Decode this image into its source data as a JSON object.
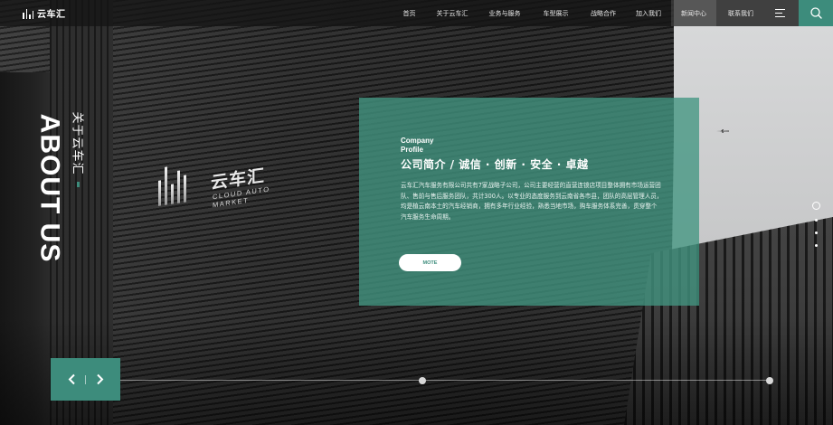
{
  "brand": {
    "logo_text": "云车汇",
    "accent_color": "#3d8c7c"
  },
  "nav": {
    "items": [
      {
        "label": "首页",
        "active": false
      },
      {
        "label": "关于云车汇",
        "active": false
      },
      {
        "label": "业务与服务",
        "active": false
      },
      {
        "label": "车型展示",
        "active": false
      },
      {
        "label": "战略合作",
        "active": false
      },
      {
        "label": "加入我们",
        "active": false
      },
      {
        "label": "新闻中心",
        "active": true
      },
      {
        "label": "联系我们",
        "active": false
      }
    ],
    "menu_icon": "hamburger-icon",
    "search_icon": "search-icon"
  },
  "hero": {
    "title_en": "ABOUT US",
    "title_cn": "关于云车汇"
  },
  "wall_sign": {
    "cn": "云车汇",
    "en_line1": "CLOUD AUTO",
    "en_line2": "MARKET"
  },
  "card": {
    "label_en_line1": "Company",
    "label_en_line2": "Profile",
    "heading": "公司简介 / 诚信 · 创新 · 安全 · 卓越",
    "description": "云车汇汽车服务有限公司共有7家战略子公司，公司主要经营的直营连锁店项目整体拥有市场运营团队、售前与售后服务团队，共计300人。以专业的态度服务到云南省各市县，团队的高层管理人员，均是植云南本土的汽车经销商，拥有多年行业经验，熟悉当地市场，购车服务体系完善，贯穿整个汽车服务生命周期。",
    "more_label": "MOTE"
  },
  "slider": {
    "prev_icon": "chevron-left-icon",
    "next_icon": "chevron-right-icon",
    "active_dot": 1
  }
}
